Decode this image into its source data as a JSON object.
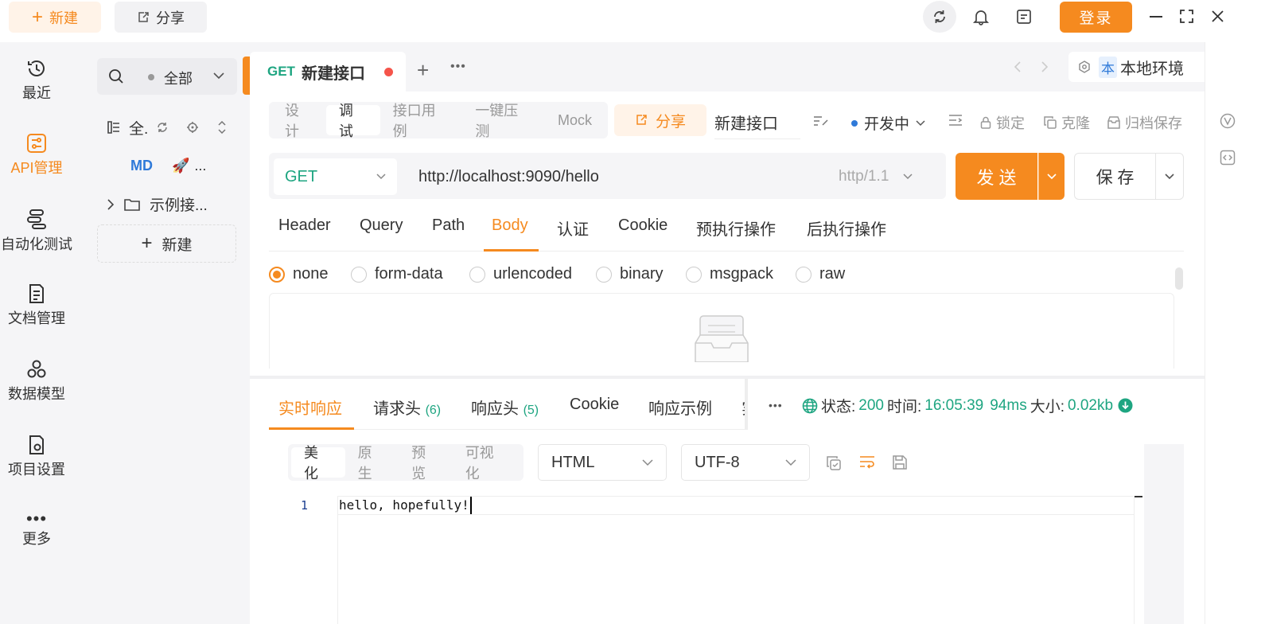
{
  "topbar": {
    "new_label": "新建",
    "share_label": "分享",
    "login_label": "登录"
  },
  "sidebar": {
    "items": [
      {
        "label": "最近",
        "icon": "history-icon"
      },
      {
        "label": "API管理",
        "icon": "api-icon"
      },
      {
        "label": "自动化测试",
        "icon": "automation-icon"
      },
      {
        "label": "文档管理",
        "icon": "doc-icon"
      },
      {
        "label": "数据模型",
        "icon": "data-model-icon"
      },
      {
        "label": "项目设置",
        "icon": "project-settings-icon"
      },
      {
        "label": "更多",
        "icon": "more-icon"
      }
    ]
  },
  "tree": {
    "filter_label": "全部",
    "root_label": "全.",
    "md_label": "MD",
    "md_more": "...",
    "folder_label": "示例接...",
    "new_label": "新建"
  },
  "tabs": {
    "method": "GET",
    "title": "新建接口"
  },
  "env": {
    "badge": "本",
    "label": "本地环境"
  },
  "modes": {
    "items": [
      "设计",
      "调试",
      "接口用例",
      "一键压测",
      "Mock"
    ],
    "active": "调试"
  },
  "toolbar": {
    "share_label": "分享",
    "name_value": "新建接口",
    "status_label": "开发中",
    "lock_label": "锁定",
    "clone_label": "克隆",
    "archive_label": "归档保存"
  },
  "request": {
    "method": "GET",
    "url": "http://localhost:9090/hello",
    "protocol": "http/1.1",
    "send_label": "发 送",
    "save_label": "保 存"
  },
  "params_tabs": {
    "items": [
      "Header",
      "Query",
      "Path",
      "Body",
      "认证",
      "Cookie",
      "预执行操作",
      "后执行操作"
    ],
    "active": "Body"
  },
  "body_types": {
    "items": [
      "none",
      "form-data",
      "urlencoded",
      "binary",
      "msgpack",
      "raw"
    ],
    "selected": "none"
  },
  "response_tabs": {
    "live": "实时响应",
    "req_headers": "请求头",
    "req_headers_count": "(6)",
    "resp_headers": "响应头",
    "resp_headers_count": "(5)",
    "cookie": "Cookie",
    "example": "响应示例",
    "cut": "实"
  },
  "response_status": {
    "status_label": "状态:",
    "status_value": "200",
    "time_label": "时间:",
    "time_value": "16:05:39",
    "duration": "94ms",
    "size_label": "大小:",
    "size_value": "0.02kb"
  },
  "view_modes": {
    "items": [
      "美化",
      "原生",
      "预览",
      "可视化"
    ],
    "active": "美化"
  },
  "format_select": "HTML",
  "encoding_select": "UTF-8",
  "response_body": {
    "line_number": "1",
    "content": "hello, hopefully!"
  },
  "colors": {
    "accent": "#f58a1f",
    "success": "#1ea581",
    "get_method": "#1ea581",
    "md_blue": "#2f7ad9"
  }
}
